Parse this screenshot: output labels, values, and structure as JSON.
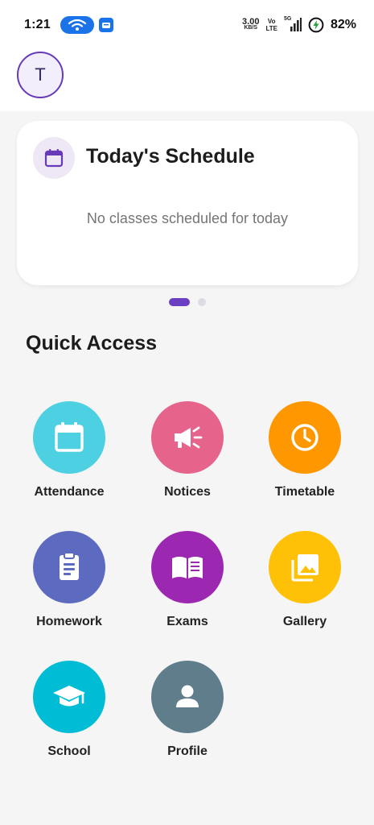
{
  "status_bar": {
    "time": "1:21",
    "net_speed_value": "3.00",
    "net_speed_unit": "KB/S",
    "volte_top": "Vo",
    "volte_bottom": "LTE",
    "network_type": "5G",
    "battery_percent": "82%"
  },
  "header": {
    "avatar_initial": "T"
  },
  "schedule_card": {
    "title": "Today's Schedule",
    "empty_message": "No classes scheduled for today",
    "page_count": 2,
    "active_page": 1
  },
  "quick_access": {
    "title": "Quick Access",
    "items": [
      {
        "label": "Attendance",
        "icon": "calendar-icon",
        "color": "#4dd0e1"
      },
      {
        "label": "Notices",
        "icon": "megaphone-icon",
        "color": "#e6648c"
      },
      {
        "label": "Timetable",
        "icon": "clock-icon",
        "color": "#ff9800"
      },
      {
        "label": "Homework",
        "icon": "clipboard-icon",
        "color": "#5c6bc0"
      },
      {
        "label": "Exams",
        "icon": "book-icon",
        "color": "#9c27b0"
      },
      {
        "label": "Gallery",
        "icon": "photo-library-icon",
        "color": "#ffc107"
      },
      {
        "label": "School",
        "icon": "graduation-cap-icon",
        "color": "#00bcd4"
      },
      {
        "label": "Profile",
        "icon": "person-icon",
        "color": "#607d8b"
      }
    ]
  },
  "colors": {
    "accent": "#673ab7",
    "background": "#f5f5f5",
    "surface": "#ffffff"
  }
}
